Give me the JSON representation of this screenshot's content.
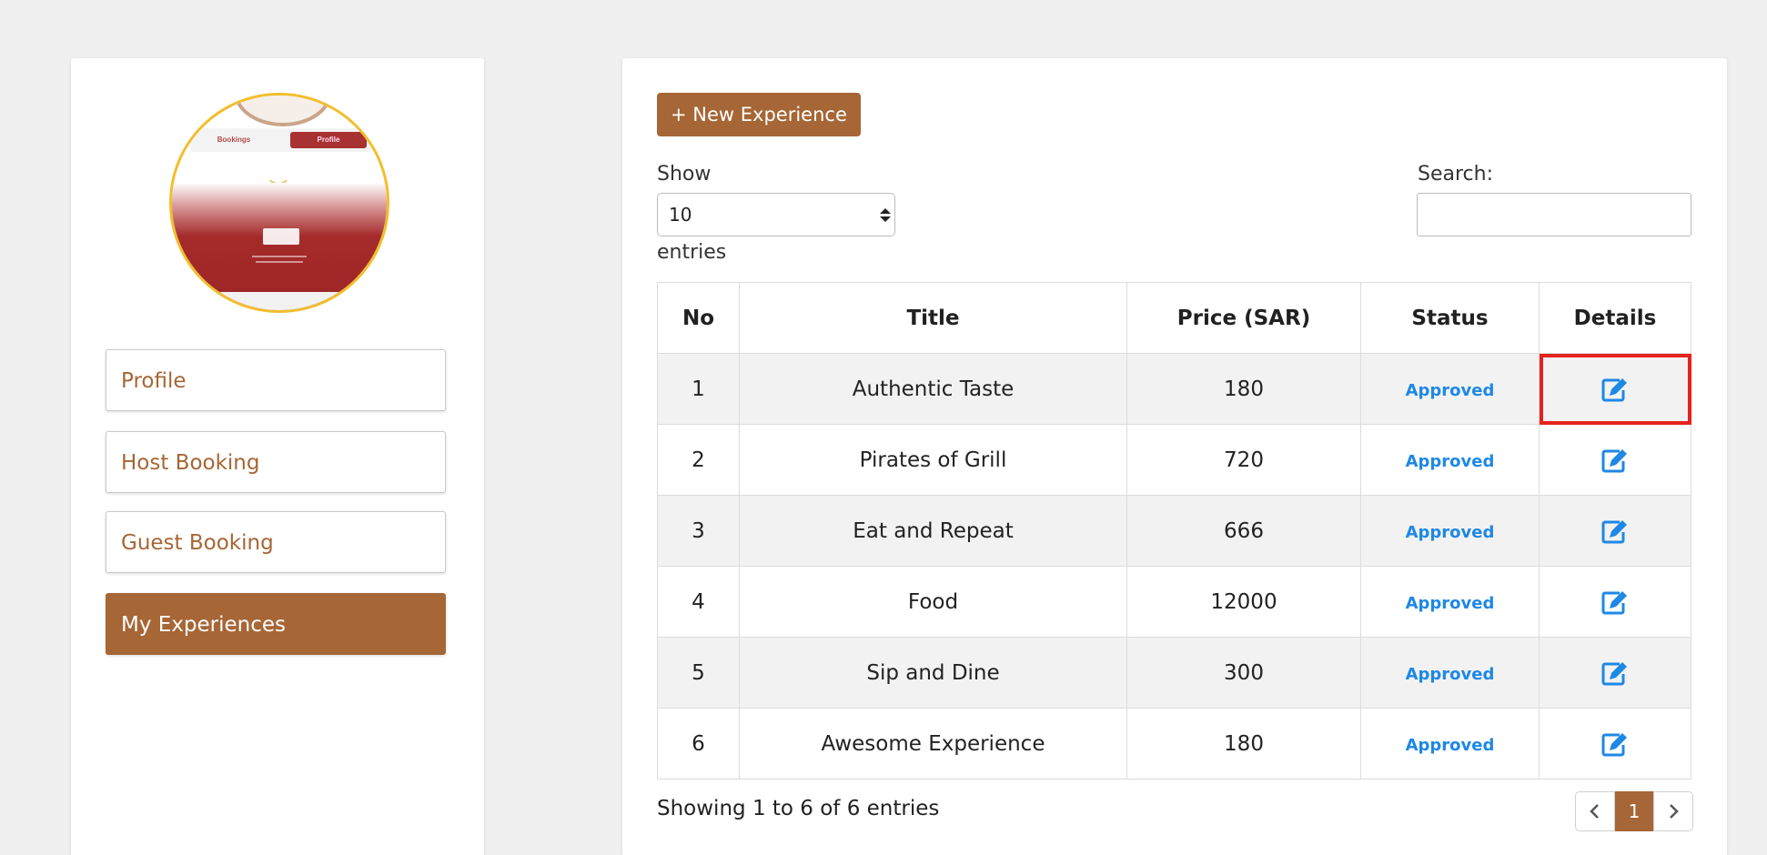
{
  "sidebar": {
    "avatar_tabs": [
      "Bookings",
      "Profile"
    ],
    "items": [
      {
        "label": "Profile"
      },
      {
        "label": "Host Booking"
      },
      {
        "label": "Guest Booking"
      },
      {
        "label": "My Experiences",
        "active": true
      }
    ]
  },
  "toolbar": {
    "new_label": "+ New Experience"
  },
  "length": {
    "show_label": "Show",
    "value": "10",
    "entries_label": "entries"
  },
  "search": {
    "label": "Search:",
    "value": ""
  },
  "table": {
    "headers": [
      "No",
      "Title",
      "Price (SAR)",
      "Status",
      "Details"
    ],
    "rows": [
      {
        "no": "1",
        "title": "Authentic Taste",
        "price": "180",
        "status": "Approved"
      },
      {
        "no": "2",
        "title": "Pirates of Grill",
        "price": "720",
        "status": "Approved"
      },
      {
        "no": "3",
        "title": "Eat and Repeat",
        "price": "666",
        "status": "Approved"
      },
      {
        "no": "4",
        "title": "Food",
        "price": "12000",
        "status": "Approved"
      },
      {
        "no": "5",
        "title": "Sip and Dine",
        "price": "300",
        "status": "Approved"
      },
      {
        "no": "6",
        "title": "Awesome Experience",
        "price": "180",
        "status": "Approved"
      }
    ]
  },
  "info": "Showing 1 to 6 of 6 entries",
  "pagination": {
    "current": "1"
  },
  "icons": {
    "edit": "edit-icon",
    "prev": "chevron-left-icon",
    "next": "chevron-right-icon",
    "select": "sort-arrows-icon"
  },
  "colors": {
    "brand": "#a66635",
    "status": "#1e88e5",
    "highlight": "#e5231c",
    "avatar_border": "#f2be2c"
  }
}
